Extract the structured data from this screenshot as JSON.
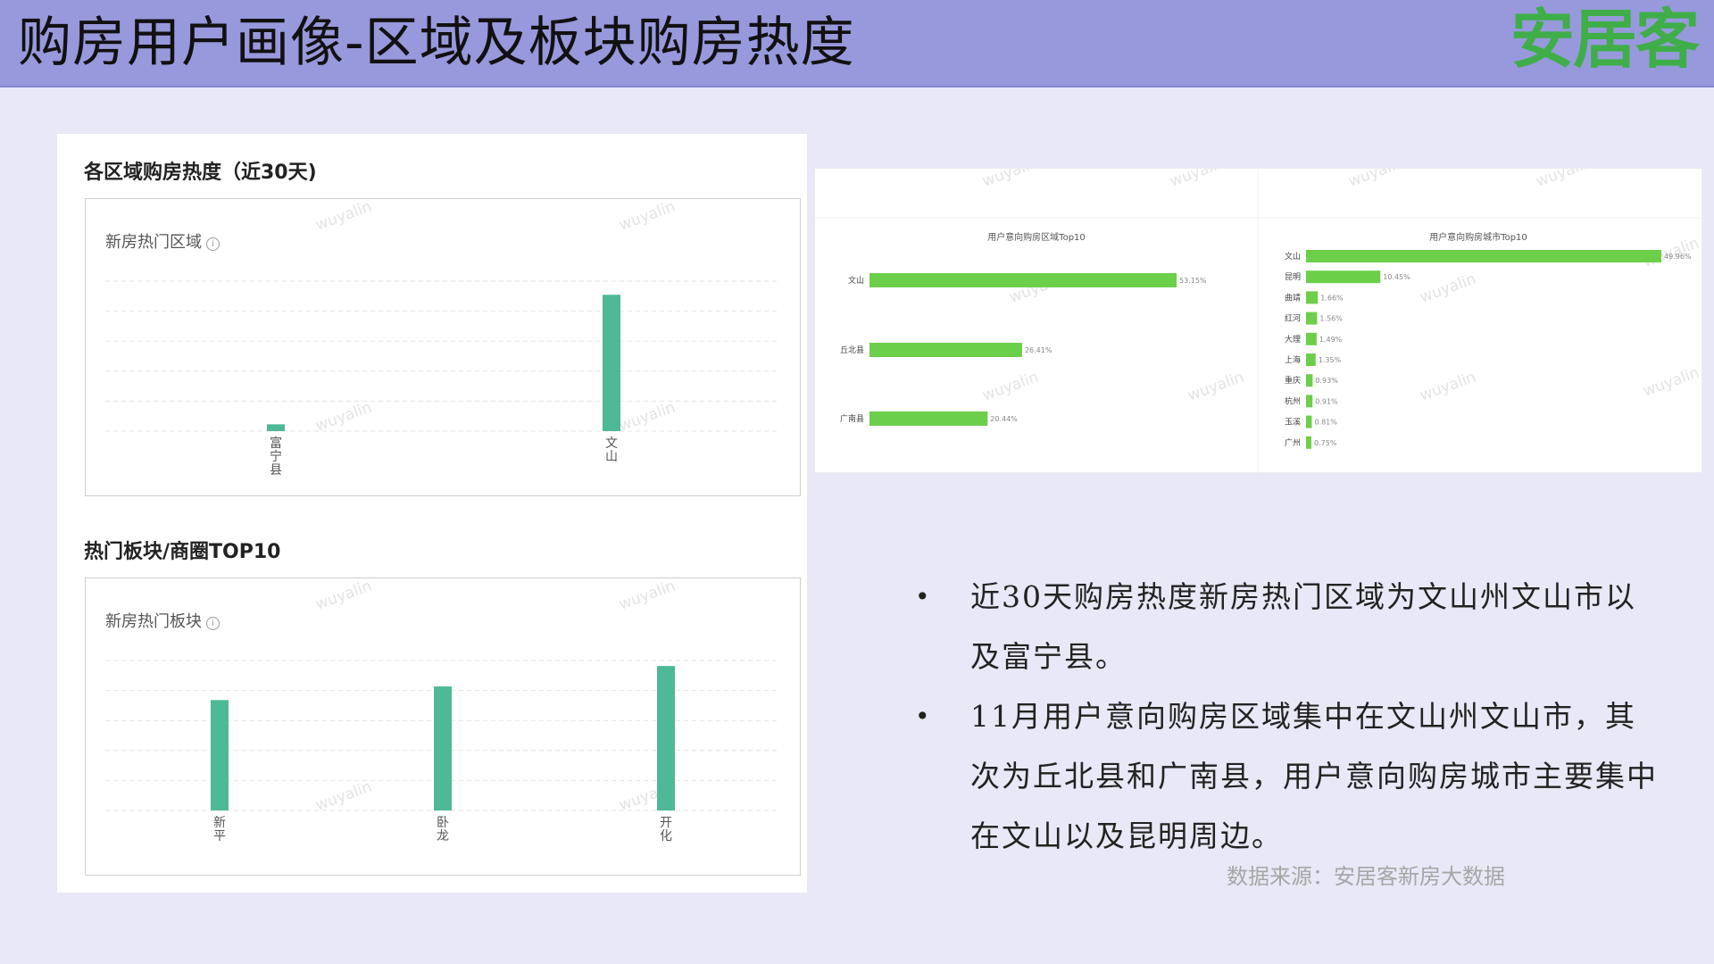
{
  "header": {
    "title": "购房用户画像-区域及板块购房热度",
    "logo": "安居客",
    "background_color": "#9799dc",
    "logo_color": "#3fae49"
  },
  "left": {
    "section1_title": "各区域购房热度（近30天)",
    "section2_title": "热门板块/商圈TOP10",
    "info_icon": "info-circle-icon"
  },
  "watermark": "wuyalin",
  "chart_data": [
    {
      "type": "bar",
      "subtitle": "新房热门区域",
      "categories": [
        "富宁县",
        "文山"
      ],
      "values": [
        5,
        100
      ],
      "ylim": [
        0,
        110
      ],
      "grid": true,
      "color": "#4db996"
    },
    {
      "type": "bar",
      "subtitle": "新房热门板块",
      "categories": [
        "新平",
        "卧龙",
        "开化"
      ],
      "values": [
        81,
        91,
        106
      ],
      "ylim": [
        0,
        110
      ],
      "grid": true,
      "color": "#4db996"
    },
    {
      "type": "bar",
      "orientation": "horizontal",
      "title": "用户意向购房区域Top10",
      "categories": [
        "文山",
        "丘北县",
        "广南县"
      ],
      "values": [
        53.15,
        26.41,
        20.44
      ],
      "labels": [
        "53.15%",
        "26.41%",
        "20.44%"
      ],
      "color": "#6ccf4a"
    },
    {
      "type": "bar",
      "orientation": "horizontal",
      "title": "用户意向购房城市Top10",
      "categories": [
        "文山",
        "昆明",
        "曲靖",
        "红河",
        "大理",
        "上海",
        "重庆",
        "杭州",
        "玉溪",
        "广州"
      ],
      "values": [
        49.96,
        10.45,
        1.66,
        1.56,
        1.49,
        1.35,
        0.93,
        0.91,
        0.81,
        0.75
      ],
      "labels": [
        "49.96%",
        "10.45%",
        "1.66%",
        "1.56%",
        "1.49%",
        "1.35%",
        "0.93%",
        "0.91%",
        "0.81%",
        "0.75%"
      ],
      "color": "#6ccf4a"
    }
  ],
  "bullets": [
    "近30天购房热度新房热门区域为文山州文山市以及富宁县。",
    "11月用户意向购房区域集中在文山州文山市，其次为丘北县和广南县，用户意向购房城市主要集中在文山以及昆明周边。"
  ],
  "bullet_symbol": "•",
  "source": "数据来源：安居客新房大数据"
}
